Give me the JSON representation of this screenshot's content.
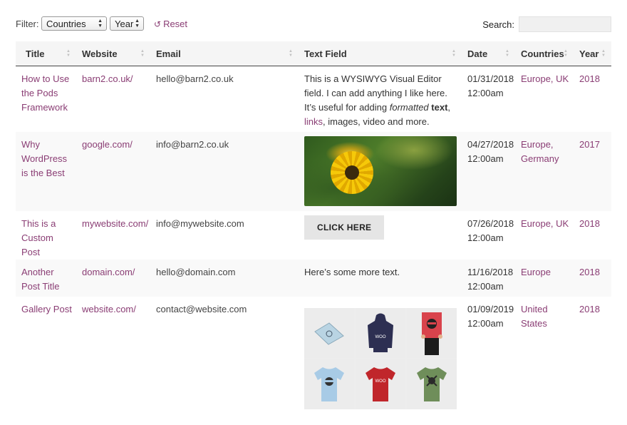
{
  "toolbar": {
    "filter_label": "Filter:",
    "countries_select": "Countries",
    "year_select": "Year",
    "reset_label": "Reset",
    "search_label": "Search:"
  },
  "columns": [
    "Title",
    "Website",
    "Email",
    "Text Field",
    "Date",
    "Countries",
    "Year"
  ],
  "rows": [
    {
      "title": "How to Use the Pods Framework",
      "website": "barn2.co.uk/",
      "email": "hello@barn2.co.uk",
      "text_pre": "This is a WYSIWYG Visual Editor field. I can add anything I like here. It’s useful for adding ",
      "text_em": "formatted",
      "text_strong": "text",
      "text_comma": ", ",
      "text_link": "links",
      "text_post": ", images, video and more.",
      "date": "01/31/2018",
      "time": "12:00am",
      "countries": "Europe, UK",
      "year": "2018"
    },
    {
      "title": "Why WordPress is the Best",
      "website": "google.com/",
      "email": "info@barn2.co.uk",
      "date": "04/27/2018",
      "time": "12:00am",
      "countries": "Europe, Germany",
      "year": "2017"
    },
    {
      "title": "This is a Custom Post",
      "website": "mywebsite.com/",
      "email": "info@mywebsite.com",
      "button_label": "CLICK HERE",
      "date": "07/26/2018",
      "time": "12:00am",
      "countries": "Europe, UK",
      "year": "2018"
    },
    {
      "title": "Another Post Title",
      "website": "domain.com/",
      "email": "hello@domain.com",
      "text": "Here’s some more text.",
      "date": "11/16/2018",
      "time": "12:00am",
      "countries": "Europe",
      "year": "2018"
    },
    {
      "title": "Gallery Post",
      "website": "website.com/",
      "email": "contact@website.com",
      "date": "01/09/2019",
      "time": "12:00am",
      "countries": "United States",
      "year": "2018",
      "gallery": [
        "poster",
        "hoodie",
        "poster-held",
        "tshirt-blue",
        "tshirt-red",
        "tshirt-green"
      ]
    }
  ]
}
